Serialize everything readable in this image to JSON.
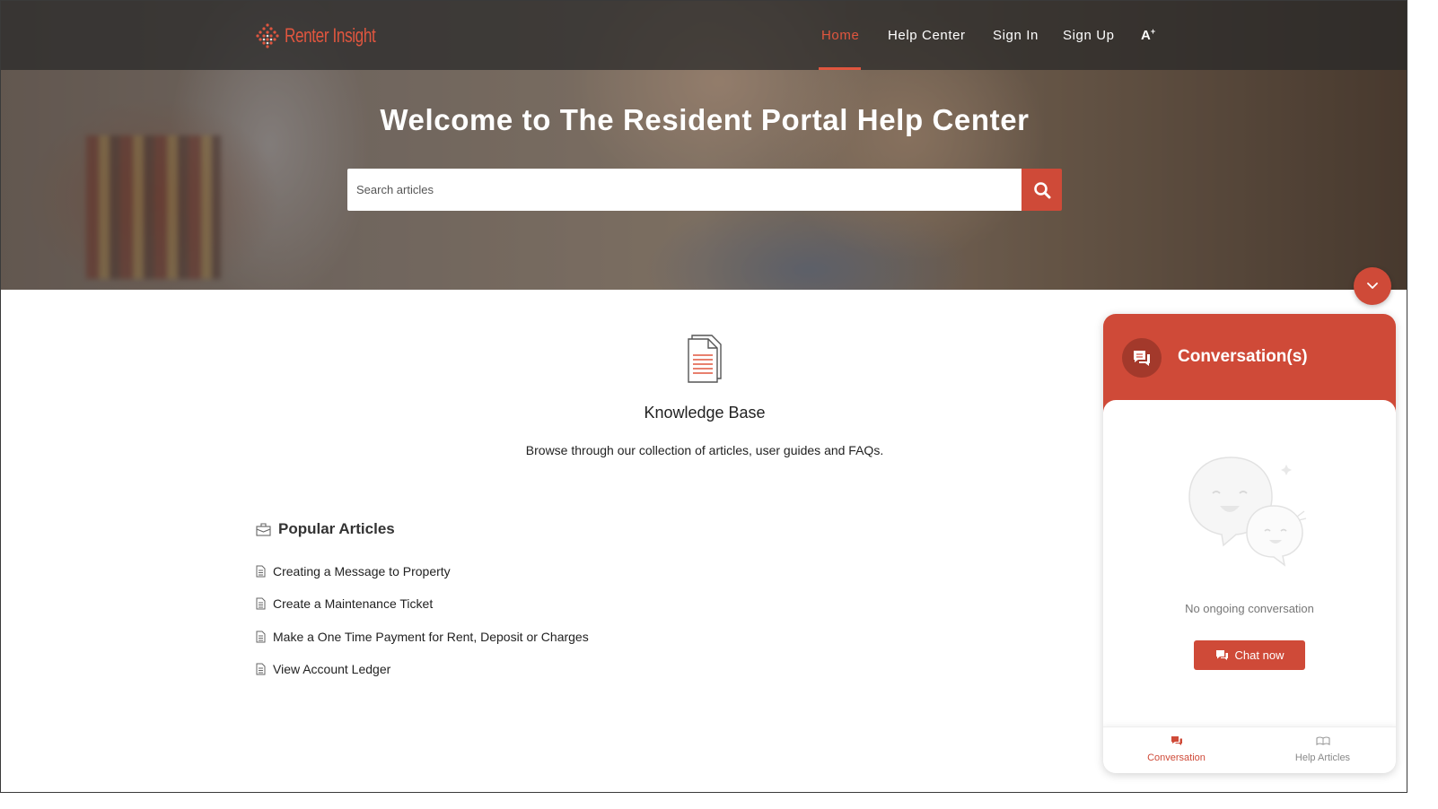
{
  "brand": {
    "name": "Renter Insight",
    "accent_color": "#cf4a38"
  },
  "nav": {
    "items": [
      {
        "label": "Home",
        "active": true
      },
      {
        "label": "Help Center",
        "active": false
      },
      {
        "label": "Sign In",
        "active": false
      },
      {
        "label": "Sign Up",
        "active": false
      }
    ],
    "font_size_icon": "A"
  },
  "hero": {
    "title": "Welcome to The Resident Portal Help Center",
    "search_placeholder": "Search articles",
    "search_icon": "search-icon"
  },
  "knowledge_base": {
    "icon": "document-icon",
    "title": "Knowledge Base",
    "description": "Browse through our collection of articles, user guides and FAQs."
  },
  "popular": {
    "title": "Popular Articles",
    "icon": "briefcase-icon",
    "articles": [
      {
        "title": "Creating a Message to Property"
      },
      {
        "title": "Create a Maintenance Ticket"
      },
      {
        "title": "Make a One Time Payment for Rent, Deposit or Charges"
      },
      {
        "title": "View Account Ledger"
      }
    ]
  },
  "chat": {
    "header_title": "Conversation(s)",
    "empty_text": "No ongoing conversation",
    "chat_now_label": "Chat now",
    "tabs": [
      {
        "label": "Conversation",
        "active": true,
        "icon": "chat-bubbles-icon"
      },
      {
        "label": "Help Articles",
        "active": false,
        "icon": "book-icon"
      }
    ],
    "collapse_icon": "chevron-down-icon"
  }
}
